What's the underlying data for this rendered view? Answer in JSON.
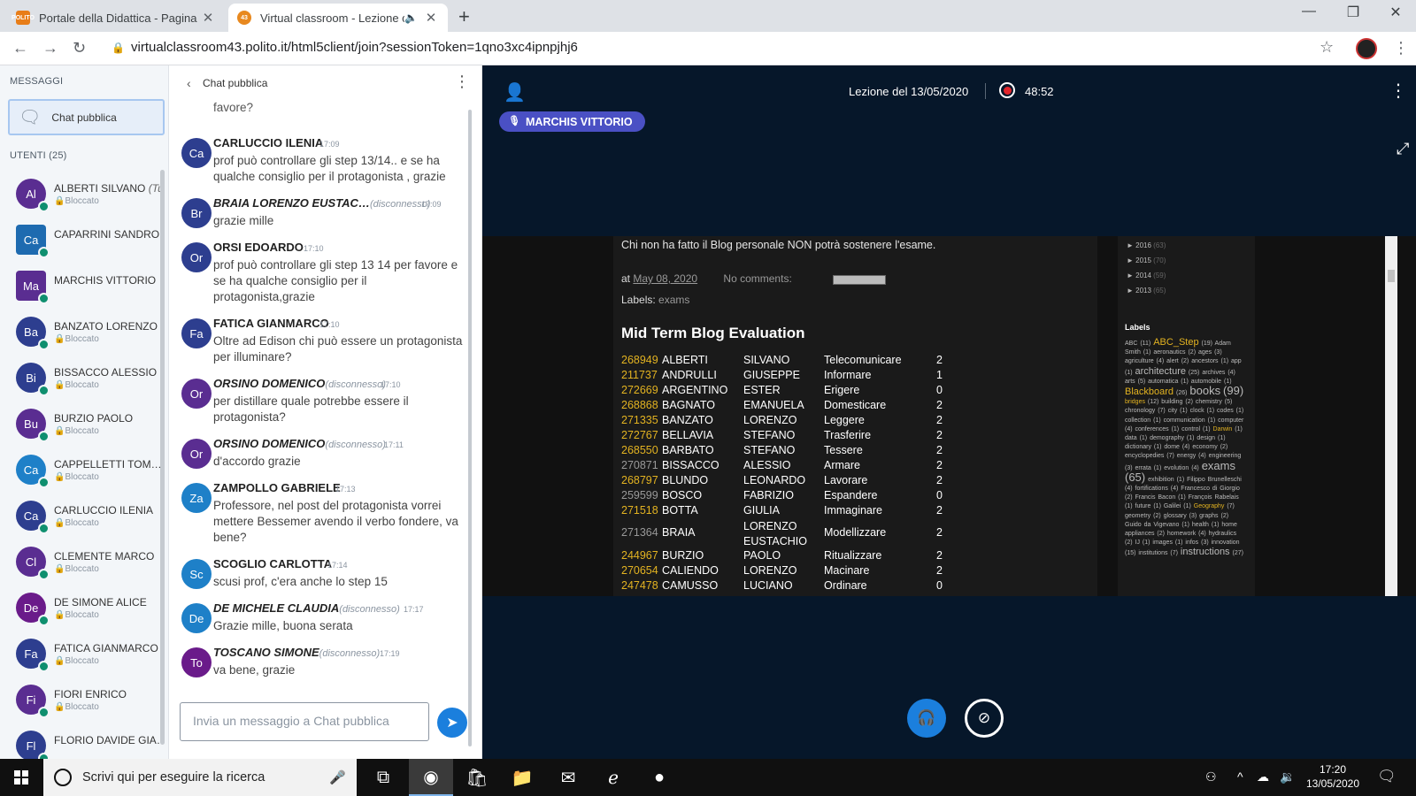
{
  "browser": {
    "tabs": [
      {
        "title": "Portale della Didattica - Pagina d",
        "favicon_text": "POLITO"
      },
      {
        "title": "Virtual classroom - Lezione c",
        "favicon_text": "43"
      }
    ],
    "url": "virtualclassroom43.polito.it/html5client/join?sessionToken=1qno3xc4ipnpjhj6"
  },
  "userpanel": {
    "messages_title": "MESSAGGI",
    "public_chat": "Chat pubblica",
    "users_title": "UTENTI (25)",
    "blocked_label": "Bloccato",
    "users": [
      {
        "initials": "Al",
        "name": "ALBERTI SILVANO",
        "you": "(Tu)",
        "color": "#5a2d91",
        "status": "Bloccato"
      },
      {
        "initials": "Ca",
        "name": "CAPARRINI SANDRO",
        "color": "#1e6bb0",
        "status": ""
      },
      {
        "initials": "Ma",
        "name": "MARCHIS VITTORIO",
        "color": "#5a2d91",
        "status": ""
      },
      {
        "initials": "Ba",
        "name": "BANZATO LORENZO",
        "color": "#2d3e8f",
        "status": "Bloccato"
      },
      {
        "initials": "Bi",
        "name": "BISSACCO ALESSIO",
        "color": "#2d3e8f",
        "status": "Bloccato"
      },
      {
        "initials": "Bu",
        "name": "BURZIO PAOLO",
        "color": "#5a2d91",
        "status": "Bloccato"
      },
      {
        "initials": "Ca",
        "name": "CAPPELLETTI TOM…",
        "color": "#1e80c8",
        "status": "Bloccato"
      },
      {
        "initials": "Ca",
        "name": "CARLUCCIO ILENIA",
        "color": "#2d3e8f",
        "status": "Bloccato"
      },
      {
        "initials": "Cl",
        "name": "CLEMENTE MARCO",
        "color": "#5a2d91",
        "status": "Bloccato"
      },
      {
        "initials": "De",
        "name": "DE SIMONE ALICE",
        "color": "#6a1b8a",
        "status": "Bloccato"
      },
      {
        "initials": "Fa",
        "name": "FATICA GIANMARCO",
        "color": "#2d3e8f",
        "status": "Bloccato"
      },
      {
        "initials": "Fi",
        "name": "FIORI ENRICO",
        "color": "#5a2d91",
        "status": "Bloccato"
      },
      {
        "initials": "Fl",
        "name": "FLORIO DAVIDE GIA…",
        "color": "#2d3e8f",
        "status": ""
      }
    ]
  },
  "chat": {
    "title": "Chat pubblica",
    "top_fragment": "favore?",
    "disconnected_label": "(disconnesso)",
    "messages": [
      {
        "initials": "Ca",
        "color": "#2d3e8f",
        "name": "CARLUCCIO ILENIA",
        "offline": false,
        "time": "17:09",
        "text": "prof può controllare gli step 13/14.. e se ha qualche consiglio per il protagonista , grazie"
      },
      {
        "initials": "Br",
        "color": "#2d3e8f",
        "name": "BRAIA LORENZO EUSTAC…",
        "offline": true,
        "time": "17:09",
        "text": "grazie mille"
      },
      {
        "initials": "Or",
        "color": "#2d3e8f",
        "name": "ORSI EDOARDO",
        "offline": false,
        "time": "17:10",
        "text": "prof può controllare gli step 13 14 per favore e se ha qualche consiglio per il protagonista,grazie"
      },
      {
        "initials": "Fa",
        "color": "#2d3e8f",
        "name": "FATICA GIANMARCO",
        "offline": false,
        "time": "17:10",
        "text": "Oltre ad Edison chi può essere un protagonista per illuminare?"
      },
      {
        "initials": "Or",
        "color": "#5a2d91",
        "name": "ORSINO DOMENICO",
        "offline": true,
        "time": "17:10",
        "text": "per distillare quale potrebbe essere il protagonista?"
      },
      {
        "initials": "Or",
        "color": "#5a2d91",
        "name": "ORSINO DOMENICO",
        "offline": true,
        "time": "17:11",
        "text": "d'accordo grazie"
      },
      {
        "initials": "Za",
        "color": "#1e80c8",
        "name": "ZAMPOLLO GABRIELE",
        "offline": false,
        "time": "17:13",
        "text": "Professore, nel post del protagonista vorrei mettere Bessemer avendo il verbo fondere, va bene?"
      },
      {
        "initials": "Sc",
        "color": "#1e80c8",
        "name": "SCOGLIO CARLOTTA",
        "offline": false,
        "time": "17:14",
        "text": "scusi prof, c'era anche lo step 15"
      },
      {
        "initials": "De",
        "color": "#1e80c8",
        "name": "DE MICHELE CLAUDIA",
        "offline": true,
        "time": "17:17",
        "text": "Grazie mille, buona serata"
      },
      {
        "initials": "To",
        "color": "#6a1b8a",
        "name": "TOSCANO SIMONE",
        "offline": true,
        "time": "17:19",
        "text": "va bene, grazie"
      }
    ],
    "input_placeholder": "Invia un messaggio a Chat pubblica"
  },
  "presentation": {
    "meeting_name": "Lezione del 13/05/2020",
    "recording_time": "48:52",
    "talker": "MARCHIS VITTORIO",
    "slide": {
      "notice": "Chi non ha fatto il Blog personale NON potrà sostenere l'esame.",
      "at_label": "at",
      "date": "May 08, 2020",
      "comments": "No comments:",
      "labels_label": "Labels:",
      "labels_value": "exams",
      "title": "Mid Term Blog Evaluation",
      "rows": [
        {
          "id": "268949",
          "surname": "ALBERTI",
          "name": "SILVANO",
          "verb": "Telecomunicare",
          "score": "2",
          "dim": false
        },
        {
          "id": "211737",
          "surname": "ANDRULLI",
          "name": "GIUSEPPE",
          "verb": "Informare",
          "score": "1",
          "dim": false
        },
        {
          "id": "272669",
          "surname": "ARGENTINO",
          "name": "ESTER",
          "verb": "Erigere",
          "score": "0",
          "dim": false
        },
        {
          "id": "268868",
          "surname": "BAGNATO",
          "name": "EMANUELA",
          "verb": "Domesticare",
          "score": "2",
          "dim": false
        },
        {
          "id": "271335",
          "surname": "BANZATO",
          "name": "LORENZO",
          "verb": "Leggere",
          "score": "2",
          "dim": false
        },
        {
          "id": "272767",
          "surname": "BELLAVIA",
          "name": "STEFANO",
          "verb": "Trasferire",
          "score": "2",
          "dim": false
        },
        {
          "id": "268550",
          "surname": "BARBATO",
          "name": "STEFANO",
          "verb": "Tessere",
          "score": "2",
          "dim": false
        },
        {
          "id": "270871",
          "surname": "BISSACCO",
          "name": "ALESSIO",
          "verb": "Armare",
          "score": "2",
          "dim": true
        },
        {
          "id": "268797",
          "surname": "BLUNDO",
          "name": "LEONARDO",
          "verb": "Lavorare",
          "score": "2",
          "dim": false
        },
        {
          "id": "259599",
          "surname": "BOSCO",
          "name": "FABRIZIO",
          "verb": "Espandere",
          "score": "0",
          "dim": true
        },
        {
          "id": "271518",
          "surname": "BOTTA",
          "name": "GIULIA",
          "verb": "Immaginare",
          "score": "2",
          "dim": false
        },
        {
          "id": "271364",
          "surname": "BRAIA",
          "name": "LORENZO EUSTACHIO",
          "verb": "Modellizzare",
          "score": "2",
          "dim": true
        },
        {
          "id": "244967",
          "surname": "BURZIO",
          "name": "PAOLO",
          "verb": "Ritualizzare",
          "score": "2",
          "dim": false
        },
        {
          "id": "270654",
          "surname": "CALIENDO",
          "name": "LORENZO",
          "verb": "Macinare",
          "score": "2",
          "dim": false
        },
        {
          "id": "247478",
          "surname": "CAMUSSO",
          "name": "LUCIANO",
          "verb": "Ordinare",
          "score": "0",
          "dim": false
        }
      ],
      "archive": [
        {
          "year": "2016",
          "count": "(63)"
        },
        {
          "year": "2015",
          "count": "(70)"
        },
        {
          "year": "2014",
          "count": "(59)"
        },
        {
          "year": "2013",
          "count": "(65)"
        }
      ],
      "labels_header": "Labels"
    }
  },
  "taskbar": {
    "search_placeholder": "Scrivi qui per eseguire la ricerca",
    "time": "17:20",
    "date": "13/05/2020"
  }
}
